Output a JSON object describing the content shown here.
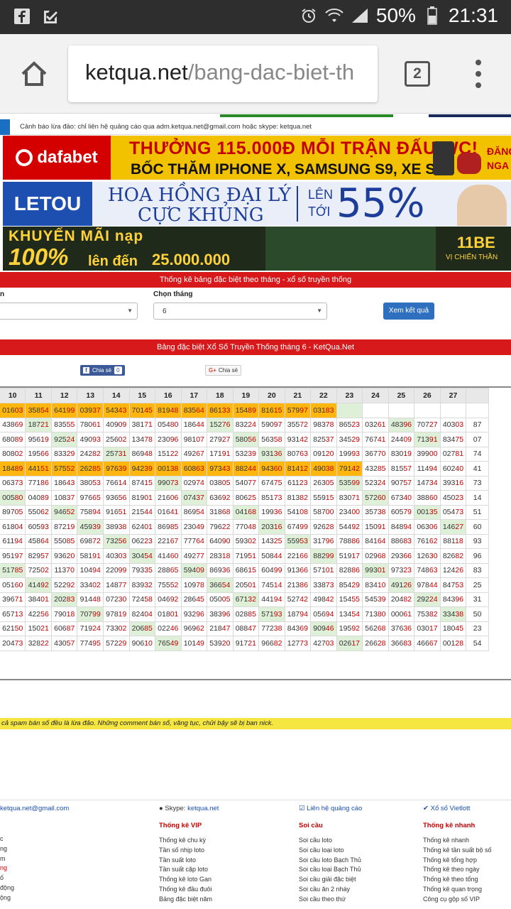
{
  "status_bar": {
    "battery": "50%",
    "time": "21:31",
    "icons": [
      "facebook-icon",
      "check-icon",
      "alarm-icon",
      "wifi-icon",
      "signal-icon",
      "battery-icon"
    ]
  },
  "browser": {
    "url_domain": "ketqua.net",
    "url_path": "/bang-dac-biet-th",
    "tab_count": "2"
  },
  "warning": "Cảnh báo lừa đảo: chỉ liên hệ quảng cáo qua adm.ketqua.net@gmail.com hoặc skype: ketqua.net",
  "banners": {
    "dafabet": {
      "logo": "dafabet",
      "line1": "THƯỞNG 115.000Đ MỖI TRẬN ĐẤU WC!",
      "line2": "BỐC THĂM IPHONE X, SAMSUNG S9, XE SH",
      "side1": "ĐĂNG",
      "side2": "NGA"
    },
    "letou": {
      "logo": "LETOU",
      "line1": "HOA HỒNG ĐẠI LÝ",
      "line2": "CỰC KHỦNG",
      "lt1": "LÊN",
      "lt2": "TỚI",
      "pct": "55%"
    },
    "promo": {
      "line1": "KHUYẾN MÃI nạp",
      "big": "100%",
      "line2": "lên đến",
      "amount": "25.000.000",
      "right1": "11BE",
      "right2": "VỊ CHIẾN THẦN"
    }
  },
  "section_title": "Thống kê bảng đặc biệt theo tháng - xổ số truyền thống",
  "form": {
    "month_label": "Chọn tháng",
    "year_label": "n",
    "month_value": "6",
    "submit_label": "Xem kết quả"
  },
  "table_title": "Bảng đặc biệt Xổ Số Truyền Thống tháng 6 - KetQua.Net",
  "share": {
    "fb_label": "Chia sẻ",
    "fb_count": "0",
    "gplus_label": "Chia sẻ"
  },
  "table": {
    "headers": [
      "",
      "10",
      "11",
      "12",
      "13",
      "14",
      "15",
      "16",
      "17",
      "18",
      "19",
      "20",
      "21",
      "22",
      "23",
      "24",
      "25",
      "26",
      "27",
      ""
    ],
    "rows": [
      [
        "0",
        "01603",
        "35854",
        "64199",
        "03937",
        "54343",
        "70145",
        "81948",
        "83564",
        "86133",
        "15489",
        "81615",
        "57997",
        "03183",
        "",
        "",
        "",
        "",
        "",
        ""
      ],
      [
        "2",
        "43869",
        "18721",
        "83555",
        "78061",
        "40909",
        "38171",
        "05480",
        "18644",
        "15276",
        "83224",
        "59097",
        "35572",
        "98378",
        "86523",
        "03261",
        "48396",
        "70727",
        "40303",
        "87"
      ],
      [
        "0",
        "68089",
        "95619",
        "92524",
        "49093",
        "25602",
        "13478",
        "23096",
        "98107",
        "27927",
        "58056",
        "56358",
        "93142",
        "82537",
        "34529",
        "76741",
        "24409",
        "71391",
        "83475",
        "07"
      ],
      [
        "0",
        "80802",
        "19566",
        "83329",
        "24282",
        "25731",
        "86948",
        "15122",
        "49267",
        "17191",
        "53239",
        "93136",
        "80763",
        "09120",
        "19993",
        "36770",
        "83019",
        "39900",
        "02781",
        "74"
      ],
      [
        "0",
        "18489",
        "44151",
        "57552",
        "26285",
        "97639",
        "94239",
        "00138",
        "60863",
        "97343",
        "88244",
        "94360",
        "81412",
        "49038",
        "79142",
        "43285",
        "81557",
        "11494",
        "60240",
        "41"
      ],
      [
        "5",
        "06373",
        "77186",
        "18643",
        "38053",
        "76614",
        "87415",
        "99073",
        "02974",
        "03805",
        "54077",
        "67475",
        "61123",
        "26305",
        "53599",
        "52324",
        "90757",
        "14734",
        "39316",
        "73"
      ],
      [
        "5",
        "00580",
        "04089",
        "10837",
        "97665",
        "93656",
        "81901",
        "21606",
        "07437",
        "63692",
        "80625",
        "85173",
        "81382",
        "55915",
        "83071",
        "57260",
        "67340",
        "38860",
        "45023",
        "14"
      ],
      [
        "3",
        "89705",
        "55062",
        "94652",
        "75894",
        "91651",
        "21544",
        "01641",
        "86954",
        "31868",
        "04168",
        "19936",
        "54108",
        "58700",
        "23400",
        "35738",
        "60579",
        "00135",
        "05473",
        "51"
      ],
      [
        "4",
        "61804",
        "60593",
        "87219",
        "45939",
        "38938",
        "62401",
        "86985",
        "23049",
        "79622",
        "77048",
        "20316",
        "67499",
        "92628",
        "54492",
        "15091",
        "84894",
        "06306",
        "14627",
        "60"
      ],
      [
        "2",
        "61194",
        "45864",
        "55085",
        "69872",
        "73256",
        "06223",
        "22167",
        "77764",
        "64090",
        "59302",
        "14325",
        "55953",
        "31796",
        "78886",
        "84164",
        "88683",
        "76162",
        "88118",
        "93"
      ],
      [
        "5",
        "95197",
        "82957",
        "93620",
        "58191",
        "40303",
        "30454",
        "41460",
        "49277",
        "28318",
        "71951",
        "50844",
        "22166",
        "88299",
        "51917",
        "02968",
        "29366",
        "12630",
        "82682",
        "96"
      ],
      [
        "9",
        "51785",
        "72502",
        "11370",
        "10494",
        "22099",
        "79335",
        "28865",
        "59409",
        "86936",
        "68615",
        "60499",
        "91366",
        "57101",
        "82886",
        "99301",
        "97323",
        "74863",
        "12426",
        "83"
      ],
      [
        "0",
        "05160",
        "41492",
        "52292",
        "33402",
        "14877",
        "83932",
        "75552",
        "10978",
        "36654",
        "20501",
        "74514",
        "21386",
        "33873",
        "85429",
        "83410",
        "49126",
        "97844",
        "84753",
        "25"
      ],
      [
        "2",
        "39671",
        "38401",
        "20283",
        "91448",
        "07230",
        "72458",
        "04692",
        "28645",
        "05005",
        "67132",
        "44194",
        "52742",
        "49842",
        "15455",
        "54539",
        "20482",
        "29224",
        "84396",
        "31"
      ],
      [
        "6",
        "65713",
        "42256",
        "79018",
        "70799",
        "97819",
        "82404",
        "01801",
        "93296",
        "38396",
        "02885",
        "57193",
        "18794",
        "05694",
        "13454",
        "71380",
        "00061",
        "75382",
        "33438",
        "50"
      ],
      [
        "9",
        "62150",
        "15021",
        "60687",
        "71924",
        "73302",
        "20685",
        "02246",
        "96962",
        "21847",
        "08847",
        "77238",
        "84369",
        "90946",
        "19592",
        "56268",
        "37636",
        "03017",
        "18045",
        "23"
      ],
      [
        "0",
        "20473",
        "32822",
        "43057",
        "77495",
        "57229",
        "90610",
        "76549",
        "10149",
        "53920",
        "91721",
        "96682",
        "12773",
        "42703",
        "02617",
        "26628",
        "36683",
        "46667",
        "00128",
        "54"
      ]
    ]
  },
  "spam_notice": "cả spam bán số đều là lừa đảo. Những comment bán số, văng tục, chửi bậy sẽ bị ban nick.",
  "footer": {
    "email": "ketqua.net@gmail.com",
    "skype_prefix": "Skype: ",
    "skype": "ketqua.net",
    "ads_link": "Liên hệ quảng cáo",
    "vietlott_link": "Xổ số Vietlott",
    "col0": [
      "c",
      "ng",
      "m",
      "ng",
      "ố",
      "động",
      "ộng"
    ],
    "col1": {
      "title": "Thống kê VIP",
      "items": [
        "Thống kê chu kỳ",
        "Tần số nhịp loto",
        "Tần suất loto",
        "Tần suất cặp loto",
        "Thống kê loto Gan",
        "Thống kê đầu đuôi",
        "Bảng đặc biệt năm"
      ]
    },
    "col2": {
      "title": "Soi cầu",
      "items": [
        "Soi cầu loto",
        "Soi cầu loại loto",
        "Soi cầu loto Bạch Thủ",
        "Soi cầu loại Bạch Thủ",
        "Soi cầu giải đặc biệt",
        "Soi cầu ăn 2 nháy",
        "Soi cầu theo thứ"
      ]
    },
    "col3": {
      "title": "Thống kê nhanh",
      "items": [
        "Thống kê nhanh",
        "Thống kê tần suất bộ số",
        "Thống kê tổng hợp",
        "Thống kê theo ngày",
        "Thống kê theo tổng",
        "Thống kê quan trọng",
        "Công cụ gộp số VIP"
      ]
    }
  }
}
